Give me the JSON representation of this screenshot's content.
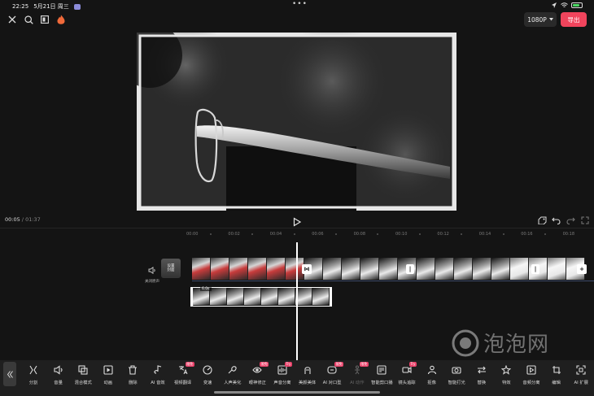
{
  "status_bar": {
    "time": "22:25",
    "date": "5月21日 周三",
    "battery_percent": 80
  },
  "top_bar": {
    "resolution": "1080P",
    "export_label": "导出"
  },
  "player": {
    "current_time": "00:05",
    "separator": " / ",
    "total_time": "01:37"
  },
  "ruler": {
    "ticks": [
      "00:00",
      "00:02",
      "00:04",
      "00:06",
      "00:08",
      "00:10",
      "00:12",
      "00:14",
      "00:16",
      "00:18"
    ]
  },
  "tracks": {
    "mute_label": "关闭原声",
    "cover_label": "设置\n封面",
    "sub_duration": "6.0s"
  },
  "toolbar": {
    "tools": [
      {
        "label": "分割",
        "icon": "split-icon"
      },
      {
        "label": "音量",
        "icon": "volume-icon"
      },
      {
        "label": "混合模式",
        "icon": "blend-icon"
      },
      {
        "label": "动画",
        "icon": "animation-icon"
      },
      {
        "label": "删除",
        "icon": "delete-icon"
      },
      {
        "label": "AI 音效",
        "icon": "ai-sound-icon"
      },
      {
        "label": "视频翻译",
        "icon": "translate-icon",
        "badge": "限免"
      },
      {
        "label": "变速",
        "icon": "speed-icon"
      },
      {
        "label": "人声美化",
        "icon": "voice-beautify-icon"
      },
      {
        "label": "眼神修正",
        "icon": "eye-correct-icon",
        "badge": "限免"
      },
      {
        "label": "声音分离",
        "icon": "audio-separate-icon",
        "badge": "Try"
      },
      {
        "label": "美颜美体",
        "icon": "beauty-icon"
      },
      {
        "label": "AI 对口型",
        "icon": "lip-sync-icon",
        "badge": "限免"
      },
      {
        "label": "AI 动作",
        "icon": "ai-motion-icon",
        "badge": "限免",
        "dim": true
      },
      {
        "label": "智能剪口播",
        "icon": "smart-cut-icon"
      },
      {
        "label": "镜头追踪",
        "icon": "tracking-icon",
        "badge": "Try"
      },
      {
        "label": "抠像",
        "icon": "cutout-icon"
      },
      {
        "label": "智能打光",
        "icon": "relight-icon"
      },
      {
        "label": "替换",
        "icon": "replace-icon"
      },
      {
        "label": "特效",
        "icon": "effects-icon"
      },
      {
        "label": "音频分离",
        "icon": "extract-audio-icon"
      },
      {
        "label": "编辑",
        "icon": "edit-icon"
      },
      {
        "label": "AI 扩展",
        "icon": "ai-expand-icon"
      }
    ]
  },
  "watermark": {
    "text": "泡泡网"
  }
}
